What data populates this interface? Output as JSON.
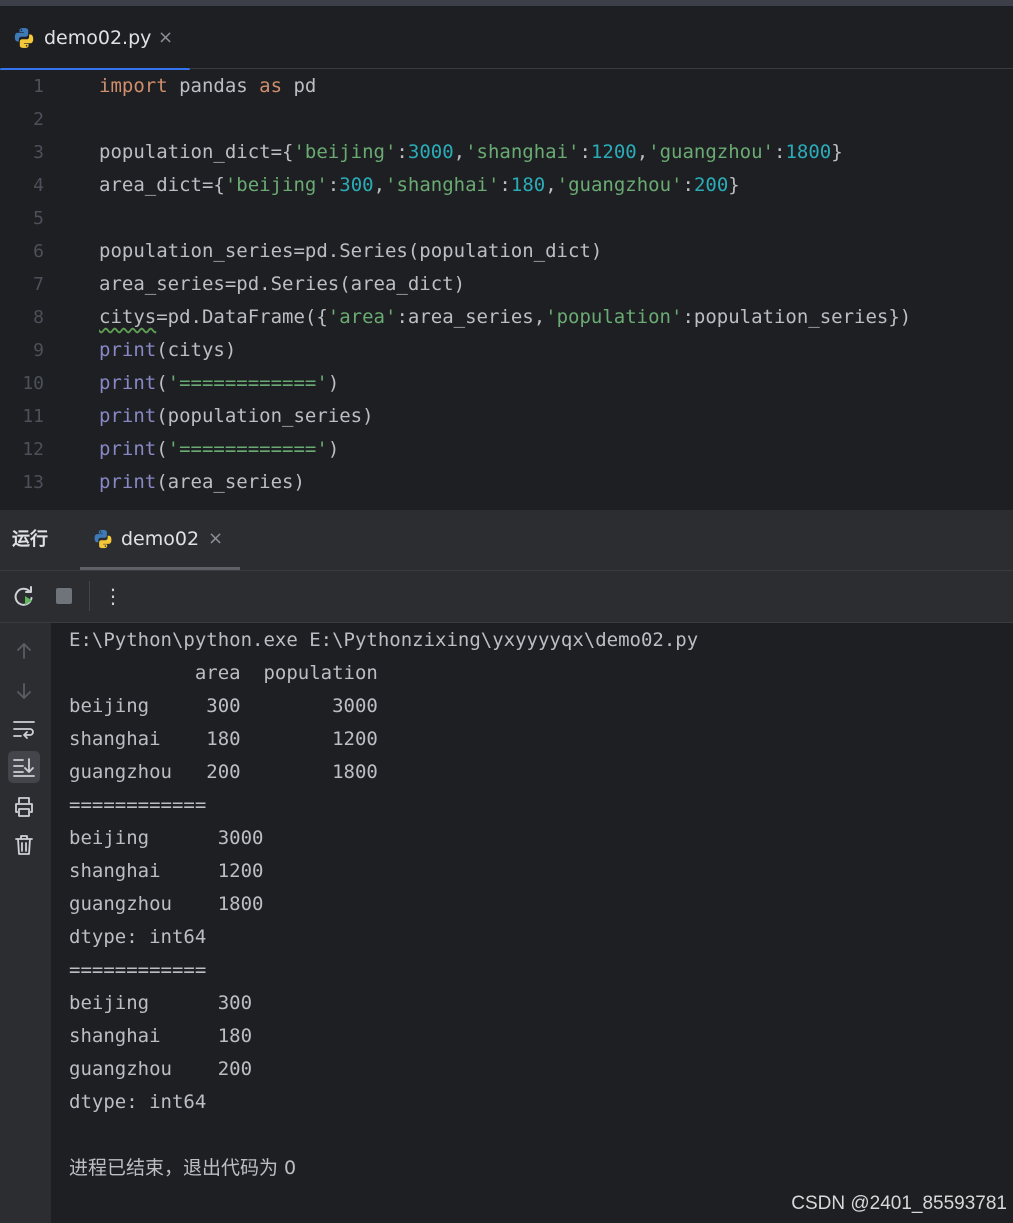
{
  "editor_tab": {
    "title": "demo02.py",
    "close": "×"
  },
  "editor": {
    "line_numbers": [
      "1",
      "2",
      "3",
      "4",
      "5",
      "6",
      "7",
      "8",
      "9",
      "10",
      "11",
      "12",
      "13"
    ],
    "lines": [
      [
        {
          "t": "import",
          "c": "kw"
        },
        {
          "t": " pandas ",
          "c": ""
        },
        {
          "t": "as",
          "c": "kw"
        },
        {
          "t": " pd",
          "c": ""
        }
      ],
      [],
      [
        {
          "t": "population_dict={",
          "c": ""
        },
        {
          "t": "'beijing'",
          "c": "str"
        },
        {
          "t": ":",
          "c": ""
        },
        {
          "t": "3000",
          "c": "num"
        },
        {
          "t": ",",
          "c": ""
        },
        {
          "t": "'shanghai'",
          "c": "str"
        },
        {
          "t": ":",
          "c": ""
        },
        {
          "t": "1200",
          "c": "num"
        },
        {
          "t": ",",
          "c": ""
        },
        {
          "t": "'guangzhou'",
          "c": "str"
        },
        {
          "t": ":",
          "c": ""
        },
        {
          "t": "1800",
          "c": "num"
        },
        {
          "t": "}",
          "c": ""
        }
      ],
      [
        {
          "t": "area_dict={",
          "c": ""
        },
        {
          "t": "'beijing'",
          "c": "str"
        },
        {
          "t": ":",
          "c": ""
        },
        {
          "t": "300",
          "c": "num"
        },
        {
          "t": ",",
          "c": ""
        },
        {
          "t": "'shanghai'",
          "c": "str"
        },
        {
          "t": ":",
          "c": ""
        },
        {
          "t": "180",
          "c": "num"
        },
        {
          "t": ",",
          "c": ""
        },
        {
          "t": "'guangzhou'",
          "c": "str"
        },
        {
          "t": ":",
          "c": ""
        },
        {
          "t": "200",
          "c": "num"
        },
        {
          "t": "}",
          "c": ""
        }
      ],
      [],
      [
        {
          "t": "population_series=pd.Series(population_dict)",
          "c": ""
        }
      ],
      [
        {
          "t": "area_series=pd.Series(area_dict)",
          "c": ""
        }
      ],
      [
        {
          "t": "citys",
          "c": "warn"
        },
        {
          "t": "=pd.DataFrame({",
          "c": ""
        },
        {
          "t": "'area'",
          "c": "str"
        },
        {
          "t": ":area_series,",
          "c": ""
        },
        {
          "t": "'population'",
          "c": "str"
        },
        {
          "t": ":population_series})",
          "c": ""
        }
      ],
      [
        {
          "t": "print",
          "c": "fn"
        },
        {
          "t": "(citys)",
          "c": ""
        }
      ],
      [
        {
          "t": "print",
          "c": "fn"
        },
        {
          "t": "(",
          "c": ""
        },
        {
          "t": "'============'",
          "c": "str"
        },
        {
          "t": ")",
          "c": ""
        }
      ],
      [
        {
          "t": "print",
          "c": "fn"
        },
        {
          "t": "(population_series)",
          "c": ""
        }
      ],
      [
        {
          "t": "print",
          "c": "fn"
        },
        {
          "t": "(",
          "c": ""
        },
        {
          "t": "'============'",
          "c": "str"
        },
        {
          "t": ")",
          "c": ""
        }
      ],
      [
        {
          "t": "print",
          "c": "fn"
        },
        {
          "t": "(area_series)",
          "c": ""
        }
      ]
    ]
  },
  "run_panel": {
    "label": "运行",
    "tab_title": "demo02",
    "tab_close": "×",
    "toolbar": {
      "rerun": "rerun-icon",
      "stop": "stop-icon",
      "more": "⋮"
    },
    "rail_icons": [
      "arrow-up-icon",
      "arrow-down-icon",
      "soft-wrap-icon",
      "scroll-to-end-icon",
      "print-icon",
      "trash-icon"
    ],
    "output": [
      "E:\\Python\\python.exe E:\\Pythonzixing\\yxyyyyqx\\demo02.py",
      "           area  population",
      "beijing     300        3000",
      "shanghai    180        1200",
      "guangzhou   200        1800",
      "============",
      "beijing      3000",
      "shanghai     1200",
      "guangzhou    1800",
      "dtype: int64",
      "============",
      "beijing      300",
      "shanghai     180",
      "guangzhou    200",
      "dtype: int64",
      "",
      "进程已结束，退出代码为 0"
    ]
  },
  "watermark": "CSDN @2401_85593781",
  "colors": {
    "background": "#1e1f22",
    "panel": "#2b2d30",
    "keyword": "#cf8e6d",
    "string": "#6aab73",
    "number": "#2aacb8",
    "builtin": "#8888c6",
    "accent": "#3574f0"
  }
}
